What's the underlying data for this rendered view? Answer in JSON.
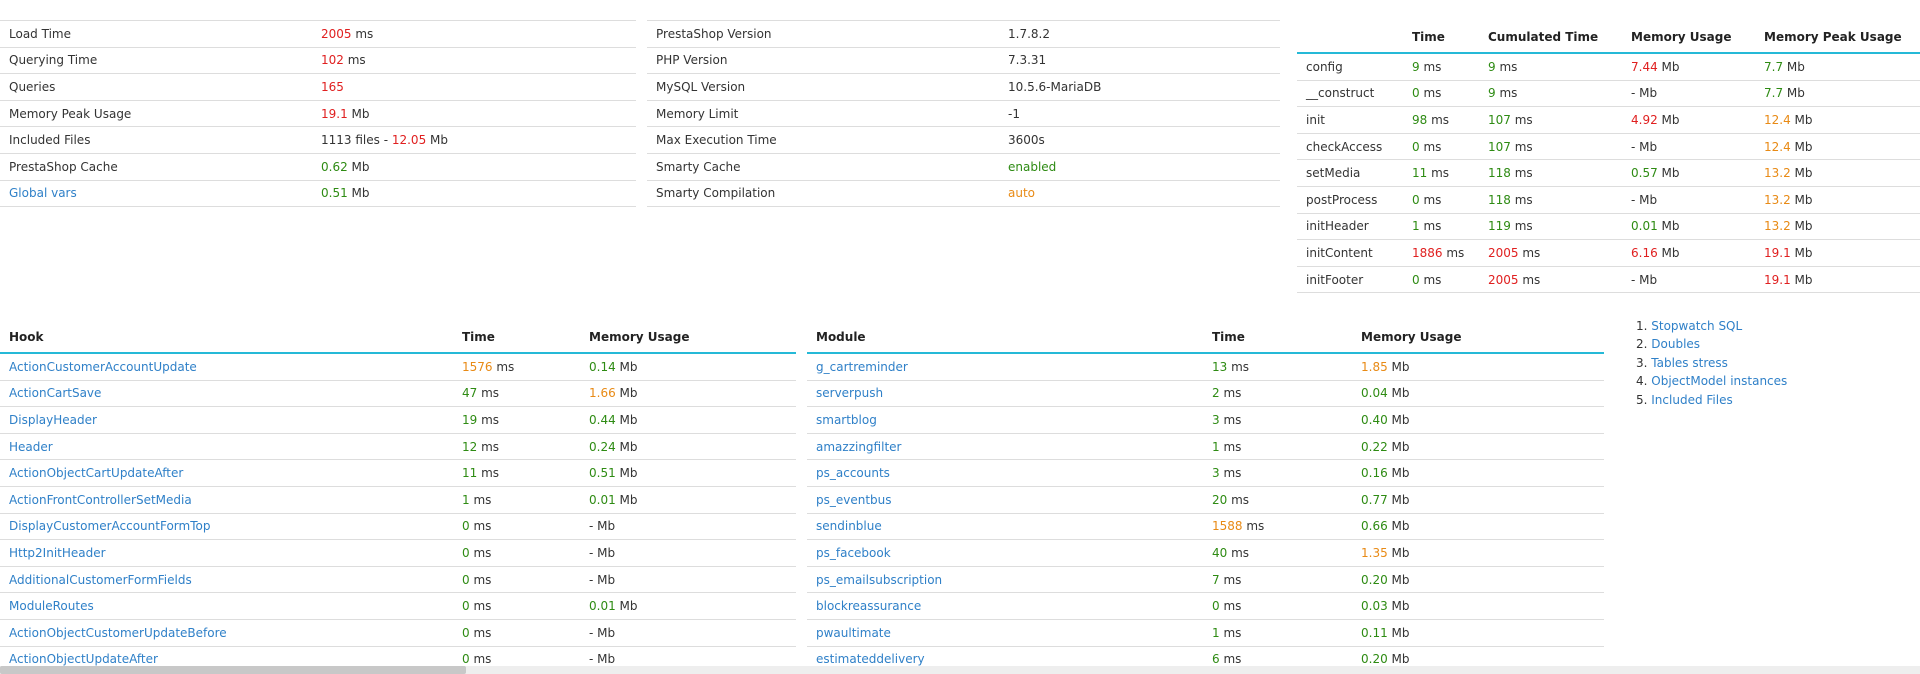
{
  "summary_left": [
    {
      "label": "Load Time",
      "value": "2005",
      "value_color": "red",
      "unit": " ms"
    },
    {
      "label": "Querying Time",
      "value": "102",
      "value_color": "red",
      "unit": " ms"
    },
    {
      "label": "Queries",
      "value": "165",
      "value_color": "red",
      "unit": ""
    },
    {
      "label": "Memory Peak Usage",
      "value": "19.1",
      "value_color": "red",
      "unit": " Mb"
    },
    {
      "label": "Included Files",
      "value": "1113 files - ",
      "value_color": "plain",
      "unit": "",
      "extra_value": "12.05",
      "extra_color": "red",
      "extra_unit": " Mb"
    },
    {
      "label": "PrestaShop Cache",
      "value": "0.62",
      "value_color": "green",
      "unit": " Mb"
    },
    {
      "label": "Global vars",
      "label_is_link": true,
      "value": "0.51",
      "value_color": "green",
      "unit": " Mb"
    }
  ],
  "summary_middle": [
    {
      "label": "PrestaShop Version",
      "value": "1.7.8.2",
      "value_color": "plain"
    },
    {
      "label": "PHP Version",
      "value": "7.3.31",
      "value_color": "plain"
    },
    {
      "label": "MySQL Version",
      "value": "10.5.6-MariaDB",
      "value_color": "plain"
    },
    {
      "label": "Memory Limit",
      "value": "-1",
      "value_color": "plain"
    },
    {
      "label": "Max Execution Time",
      "value": "3600s",
      "value_color": "plain"
    },
    {
      "label": "Smarty Cache",
      "value": "enabled",
      "value_color": "green"
    },
    {
      "label": "Smarty Compilation",
      "value": "auto",
      "value_color": "orange"
    }
  ],
  "stages": {
    "headers": [
      "",
      "Time",
      "Cumulated Time",
      "Memory Usage",
      "Memory Peak Usage"
    ],
    "rows": [
      {
        "name": "config",
        "time": "9",
        "time_color": "green",
        "cumul": "9",
        "cumul_color": "green",
        "mem": "7.44",
        "mem_color": "red",
        "peak": "7.7",
        "peak_color": "green"
      },
      {
        "name": "__construct",
        "time": "0",
        "time_color": "green",
        "cumul": "9",
        "cumul_color": "green",
        "mem": "-",
        "mem_color": "plain",
        "peak": "7.7",
        "peak_color": "green"
      },
      {
        "name": "init",
        "time": "98",
        "time_color": "green",
        "cumul": "107",
        "cumul_color": "green",
        "mem": "4.92",
        "mem_color": "red",
        "peak": "12.4",
        "peak_color": "orange"
      },
      {
        "name": "checkAccess",
        "time": "0",
        "time_color": "green",
        "cumul": "107",
        "cumul_color": "green",
        "mem": "-",
        "mem_color": "plain",
        "peak": "12.4",
        "peak_color": "orange"
      },
      {
        "name": "setMedia",
        "time": "11",
        "time_color": "green",
        "cumul": "118",
        "cumul_color": "green",
        "mem": "0.57",
        "mem_color": "green",
        "peak": "13.2",
        "peak_color": "orange"
      },
      {
        "name": "postProcess",
        "time": "0",
        "time_color": "green",
        "cumul": "118",
        "cumul_color": "green",
        "mem": "-",
        "mem_color": "plain",
        "peak": "13.2",
        "peak_color": "orange"
      },
      {
        "name": "initHeader",
        "time": "1",
        "time_color": "green",
        "cumul": "119",
        "cumul_color": "green",
        "mem": "0.01",
        "mem_color": "green",
        "peak": "13.2",
        "peak_color": "orange"
      },
      {
        "name": "initContent",
        "time": "1886",
        "time_color": "red",
        "cumul": "2005",
        "cumul_color": "red",
        "mem": "6.16",
        "mem_color": "red",
        "peak": "19.1",
        "peak_color": "red"
      },
      {
        "name": "initFooter",
        "time": "0",
        "time_color": "green",
        "cumul": "2005",
        "cumul_color": "red",
        "mem": "-",
        "mem_color": "plain",
        "peak": "19.1",
        "peak_color": "red"
      }
    ]
  },
  "hooks": {
    "headers": [
      "Hook",
      "Time",
      "Memory Usage"
    ],
    "rows": [
      {
        "name": "ActionCustomerAccountUpdate",
        "time": "1576",
        "time_color": "orange",
        "mem": "0.14",
        "mem_color": "green"
      },
      {
        "name": "ActionCartSave",
        "time": "47",
        "time_color": "green",
        "mem": "1.66",
        "mem_color": "orange"
      },
      {
        "name": "DisplayHeader",
        "time": "19",
        "time_color": "green",
        "mem": "0.44",
        "mem_color": "green"
      },
      {
        "name": "Header",
        "time": "12",
        "time_color": "green",
        "mem": "0.24",
        "mem_color": "green"
      },
      {
        "name": "ActionObjectCartUpdateAfter",
        "time": "11",
        "time_color": "green",
        "mem": "0.51",
        "mem_color": "green"
      },
      {
        "name": "ActionFrontControllerSetMedia",
        "time": "1",
        "time_color": "green",
        "mem": "0.01",
        "mem_color": "green"
      },
      {
        "name": "DisplayCustomerAccountFormTop",
        "time": "0",
        "time_color": "green",
        "mem": "-",
        "mem_color": "plain"
      },
      {
        "name": "Http2InitHeader",
        "time": "0",
        "time_color": "green",
        "mem": "-",
        "mem_color": "plain"
      },
      {
        "name": "AdditionalCustomerFormFields",
        "time": "0",
        "time_color": "green",
        "mem": "-",
        "mem_color": "plain"
      },
      {
        "name": "ModuleRoutes",
        "time": "0",
        "time_color": "green",
        "mem": "0.01",
        "mem_color": "green"
      },
      {
        "name": "ActionObjectCustomerUpdateBefore",
        "time": "0",
        "time_color": "green",
        "mem": "-",
        "mem_color": "plain"
      },
      {
        "name": "ActionObjectUpdateAfter",
        "time": "0",
        "time_color": "green",
        "mem": "-",
        "mem_color": "plain"
      }
    ]
  },
  "modules": {
    "headers": [
      "Module",
      "Time",
      "Memory Usage"
    ],
    "rows": [
      {
        "name": "g_cartreminder",
        "time": "13",
        "time_color": "green",
        "mem": "1.85",
        "mem_color": "orange"
      },
      {
        "name": "serverpush",
        "time": "2",
        "time_color": "green",
        "mem": "0.04",
        "mem_color": "green"
      },
      {
        "name": "smartblog",
        "time": "3",
        "time_color": "green",
        "mem": "0.40",
        "mem_color": "green"
      },
      {
        "name": "amazzingfilter",
        "time": "1",
        "time_color": "green",
        "mem": "0.22",
        "mem_color": "green"
      },
      {
        "name": "ps_accounts",
        "time": "3",
        "time_color": "green",
        "mem": "0.16",
        "mem_color": "green"
      },
      {
        "name": "ps_eventbus",
        "time": "20",
        "time_color": "green",
        "mem": "0.77",
        "mem_color": "green"
      },
      {
        "name": "sendinblue",
        "time": "1588",
        "time_color": "orange",
        "mem": "0.66",
        "mem_color": "green"
      },
      {
        "name": "ps_facebook",
        "time": "40",
        "time_color": "green",
        "mem": "1.35",
        "mem_color": "orange"
      },
      {
        "name": "ps_emailsubscription",
        "time": "7",
        "time_color": "green",
        "mem": "0.20",
        "mem_color": "green"
      },
      {
        "name": "blockreassurance",
        "time": "0",
        "time_color": "green",
        "mem": "0.03",
        "mem_color": "green"
      },
      {
        "name": "pwaultimate",
        "time": "1",
        "time_color": "green",
        "mem": "0.11",
        "mem_color": "green"
      },
      {
        "name": "estimateddelivery",
        "time": "6",
        "time_color": "green",
        "mem": "0.20",
        "mem_color": "green"
      }
    ]
  },
  "units": {
    "ms": " ms",
    "mb": " Mb"
  },
  "nav_links": [
    {
      "num": "1.",
      "label": "Stopwatch SQL"
    },
    {
      "num": "2.",
      "label": "Doubles"
    },
    {
      "num": "3.",
      "label": "Tables stress"
    },
    {
      "num": "4.",
      "label": "ObjectModel instances"
    },
    {
      "num": "5.",
      "label": "Included Files"
    }
  ],
  "colors": {
    "red": "#e02020",
    "green": "#2e8b13",
    "orange": "#e88a15",
    "link": "#2f80c8",
    "accent_border": "#25b9d7"
  }
}
